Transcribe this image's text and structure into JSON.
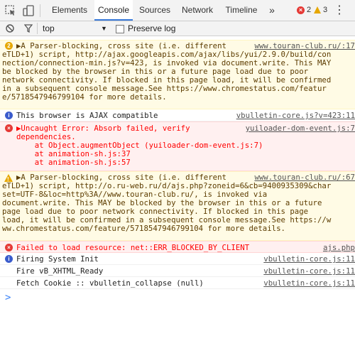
{
  "tabs": [
    "Elements",
    "Console",
    "Sources",
    "Network",
    "Timeline"
  ],
  "active_tab": "Console",
  "error_count": "2",
  "warning_count": "3",
  "filter": {
    "context": "top",
    "preserve_log_label": "Preserve log"
  },
  "messages": {
    "m1": {
      "count": "2",
      "lines": [
        "▶A Parser-blocking, cross site (i.e. different",
        "eTLD+1) script, http://ajax.googleapis.com/ajax/libs/yui/2.9.0/build/con",
        "nection/connection-min.js?v=423, is invoked via document.write. This MAY",
        "be blocked by the browser in this or a future page load due to poor",
        "network connectivity. If blocked in this page load, it will be confirmed",
        "in a subsequent console message.See https://www.chromestatus.com/featur",
        "e/5718547946799104 for more details."
      ],
      "source": "www.touran-club.ru/:17"
    },
    "m2": {
      "text": "This browser is AJAX compatible",
      "source": "vbulletin-core.js?v=423:11"
    },
    "m3": {
      "lines": [
        "▶Uncaught Error: Absorb failed, verify",
        "dependencies.",
        "    at Object.augmentObject (yuiloader-dom-event.js:7)",
        "    at animation-sh.js:37",
        "    at animation-sh.js:57"
      ],
      "source": "yuiloader-dom-event.js:7"
    },
    "m4": {
      "lines": [
        "▶A Parser-blocking, cross site (i.e. different",
        "eTLD+1) script, http://o.ru-web.ru/d/ajs.php?zoneid=6&cb=9400935309&char",
        "set=UTF-8&loc=http%3A//www.touran-club.ru/, is invoked via",
        "document.write. This MAY be blocked by the browser in this or a future",
        "page load due to poor network connectivity. If blocked in this page",
        "load, it will be confirmed in a subsequent console message.See https://w",
        "ww.chromestatus.com/feature/5718547946799104 for more details."
      ],
      "source": "www.touran-club.ru/:67"
    },
    "m5": {
      "text": "Failed to load resource: net::ERR_BLOCKED_BY_CLIENT",
      "source": "ajs.php"
    },
    "m6": {
      "text": "Firing System Init",
      "source": "vbulletin-core.js:11"
    },
    "m7": {
      "text": "Fire vB_XHTML_Ready",
      "source": "vbulletin-core.js:11"
    },
    "m8": {
      "text": "Fetch Cookie :: vbulletin_collapse (null)",
      "source": "vbulletin-core.js:11"
    }
  },
  "prompt_symbol": ">"
}
